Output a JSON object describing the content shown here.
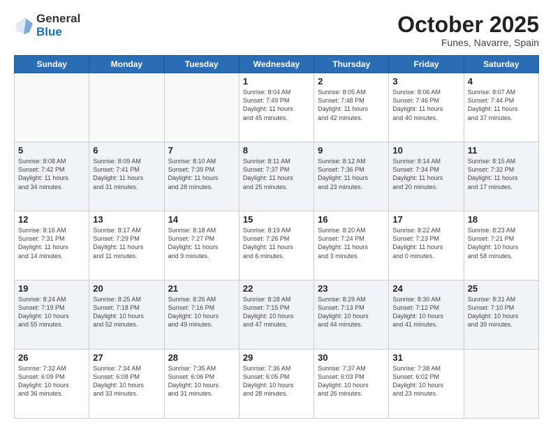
{
  "header": {
    "logo_general": "General",
    "logo_blue": "Blue",
    "month": "October 2025",
    "location": "Funes, Navarre, Spain"
  },
  "weekdays": [
    "Sunday",
    "Monday",
    "Tuesday",
    "Wednesday",
    "Thursday",
    "Friday",
    "Saturday"
  ],
  "weeks": [
    [
      {
        "day": "",
        "info": ""
      },
      {
        "day": "",
        "info": ""
      },
      {
        "day": "",
        "info": ""
      },
      {
        "day": "1",
        "info": "Sunrise: 8:04 AM\nSunset: 7:49 PM\nDaylight: 11 hours\nand 45 minutes."
      },
      {
        "day": "2",
        "info": "Sunrise: 8:05 AM\nSunset: 7:48 PM\nDaylight: 11 hours\nand 42 minutes."
      },
      {
        "day": "3",
        "info": "Sunrise: 8:06 AM\nSunset: 7:46 PM\nDaylight: 11 hours\nand 40 minutes."
      },
      {
        "day": "4",
        "info": "Sunrise: 8:07 AM\nSunset: 7:44 PM\nDaylight: 11 hours\nand 37 minutes."
      }
    ],
    [
      {
        "day": "5",
        "info": "Sunrise: 8:08 AM\nSunset: 7:42 PM\nDaylight: 11 hours\nand 34 minutes."
      },
      {
        "day": "6",
        "info": "Sunrise: 8:09 AM\nSunset: 7:41 PM\nDaylight: 11 hours\nand 31 minutes."
      },
      {
        "day": "7",
        "info": "Sunrise: 8:10 AM\nSunset: 7:39 PM\nDaylight: 11 hours\nand 28 minutes."
      },
      {
        "day": "8",
        "info": "Sunrise: 8:11 AM\nSunset: 7:37 PM\nDaylight: 11 hours\nand 25 minutes."
      },
      {
        "day": "9",
        "info": "Sunrise: 8:12 AM\nSunset: 7:36 PM\nDaylight: 11 hours\nand 23 minutes."
      },
      {
        "day": "10",
        "info": "Sunrise: 8:14 AM\nSunset: 7:34 PM\nDaylight: 11 hours\nand 20 minutes."
      },
      {
        "day": "11",
        "info": "Sunrise: 8:15 AM\nSunset: 7:32 PM\nDaylight: 11 hours\nand 17 minutes."
      }
    ],
    [
      {
        "day": "12",
        "info": "Sunrise: 8:16 AM\nSunset: 7:31 PM\nDaylight: 11 hours\nand 14 minutes."
      },
      {
        "day": "13",
        "info": "Sunrise: 8:17 AM\nSunset: 7:29 PM\nDaylight: 11 hours\nand 11 minutes."
      },
      {
        "day": "14",
        "info": "Sunrise: 8:18 AM\nSunset: 7:27 PM\nDaylight: 11 hours\nand 9 minutes."
      },
      {
        "day": "15",
        "info": "Sunrise: 8:19 AM\nSunset: 7:26 PM\nDaylight: 11 hours\nand 6 minutes."
      },
      {
        "day": "16",
        "info": "Sunrise: 8:20 AM\nSunset: 7:24 PM\nDaylight: 11 hours\nand 3 minutes."
      },
      {
        "day": "17",
        "info": "Sunrise: 8:22 AM\nSunset: 7:23 PM\nDaylight: 11 hours\nand 0 minutes."
      },
      {
        "day": "18",
        "info": "Sunrise: 8:23 AM\nSunset: 7:21 PM\nDaylight: 10 hours\nand 58 minutes."
      }
    ],
    [
      {
        "day": "19",
        "info": "Sunrise: 8:24 AM\nSunset: 7:19 PM\nDaylight: 10 hours\nand 55 minutes."
      },
      {
        "day": "20",
        "info": "Sunrise: 8:25 AM\nSunset: 7:18 PM\nDaylight: 10 hours\nand 52 minutes."
      },
      {
        "day": "21",
        "info": "Sunrise: 8:26 AM\nSunset: 7:16 PM\nDaylight: 10 hours\nand 49 minutes."
      },
      {
        "day": "22",
        "info": "Sunrise: 8:28 AM\nSunset: 7:15 PM\nDaylight: 10 hours\nand 47 minutes."
      },
      {
        "day": "23",
        "info": "Sunrise: 8:29 AM\nSunset: 7:13 PM\nDaylight: 10 hours\nand 44 minutes."
      },
      {
        "day": "24",
        "info": "Sunrise: 8:30 AM\nSunset: 7:12 PM\nDaylight: 10 hours\nand 41 minutes."
      },
      {
        "day": "25",
        "info": "Sunrise: 8:31 AM\nSunset: 7:10 PM\nDaylight: 10 hours\nand 39 minutes."
      }
    ],
    [
      {
        "day": "26",
        "info": "Sunrise: 7:32 AM\nSunset: 6:09 PM\nDaylight: 10 hours\nand 36 minutes."
      },
      {
        "day": "27",
        "info": "Sunrise: 7:34 AM\nSunset: 6:08 PM\nDaylight: 10 hours\nand 33 minutes."
      },
      {
        "day": "28",
        "info": "Sunrise: 7:35 AM\nSunset: 6:06 PM\nDaylight: 10 hours\nand 31 minutes."
      },
      {
        "day": "29",
        "info": "Sunrise: 7:36 AM\nSunset: 6:05 PM\nDaylight: 10 hours\nand 28 minutes."
      },
      {
        "day": "30",
        "info": "Sunrise: 7:37 AM\nSunset: 6:03 PM\nDaylight: 10 hours\nand 26 minutes."
      },
      {
        "day": "31",
        "info": "Sunrise: 7:38 AM\nSunset: 6:02 PM\nDaylight: 10 hours\nand 23 minutes."
      },
      {
        "day": "",
        "info": ""
      }
    ]
  ]
}
